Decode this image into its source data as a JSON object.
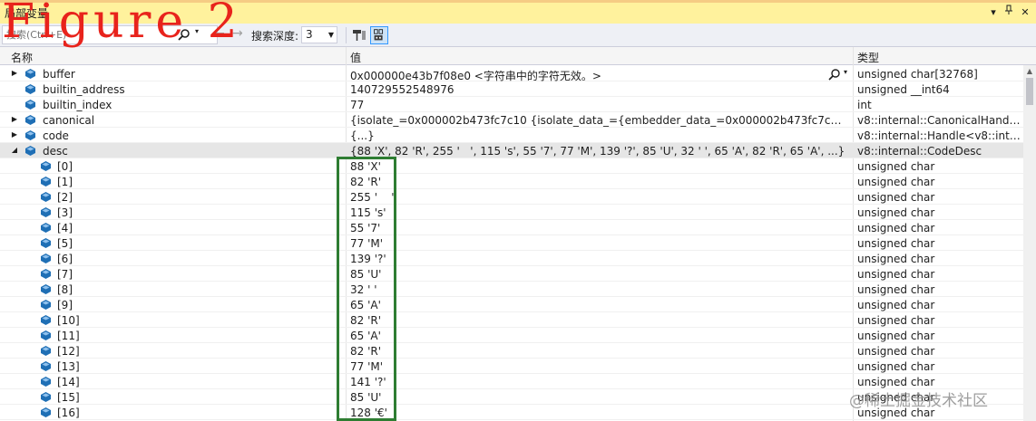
{
  "window": {
    "title": "局部变量",
    "pin_icon": "pin-icon",
    "close_icon": "close-icon"
  },
  "figure_label": "Figure 2",
  "toolbar": {
    "search_placeholder": "搜索(Ctrl+E)",
    "depth_label": "搜索深度:",
    "depth_value": "3"
  },
  "columns": {
    "name": "名称",
    "value": "值",
    "type": "类型"
  },
  "rows": [
    {
      "name": "buffer",
      "value": "0x000000e43b7f08e0 <字符串中的字符无效。>",
      "type": "unsigned char[32768]",
      "expander": "collapsed",
      "level": 0
    },
    {
      "name": "builtin_address",
      "value": "140729552548976",
      "type": "unsigned __int64",
      "expander": "none",
      "level": 0
    },
    {
      "name": "builtin_index",
      "value": "77",
      "type": "int",
      "expander": "none",
      "level": 0
    },
    {
      "name": "canonical",
      "value": "{isolate_=0x000002b473fc7c10 {isolate_data_={embedder_data_=0x000002b473fc7c10 {0x0000000000000...",
      "type": "v8::internal::CanonicalHandleSc...",
      "expander": "collapsed",
      "level": 0
    },
    {
      "name": "code",
      "value": "{...}",
      "type": "v8::internal::Handle<v8::internal:...",
      "expander": "collapsed",
      "level": 0
    },
    {
      "name": "desc",
      "value": "{88 'X', 82 'R', 255 '   ', 115 's', 55 '7', 77 'M', 139 '?', 85 'U', 32 ' ', 65 'A', 82 'R', 65 'A', ...}",
      "type": "v8::internal::CodeDesc",
      "expander": "expanded",
      "level": 0,
      "selected": true
    },
    {
      "name": "[0]",
      "value": "88 'X'",
      "type": "unsigned char",
      "expander": "none",
      "level": 1
    },
    {
      "name": "[1]",
      "value": "82 'R'",
      "type": "unsigned char",
      "expander": "none",
      "level": 1
    },
    {
      "name": "[2]",
      "value": "255 '    '",
      "type": "unsigned char",
      "expander": "none",
      "level": 1
    },
    {
      "name": "[3]",
      "value": "115 's'",
      "type": "unsigned char",
      "expander": "none",
      "level": 1
    },
    {
      "name": "[4]",
      "value": "55 '7'",
      "type": "unsigned char",
      "expander": "none",
      "level": 1
    },
    {
      "name": "[5]",
      "value": "77 'M'",
      "type": "unsigned char",
      "expander": "none",
      "level": 1
    },
    {
      "name": "[6]",
      "value": "139 '?'",
      "type": "unsigned char",
      "expander": "none",
      "level": 1
    },
    {
      "name": "[7]",
      "value": "85 'U'",
      "type": "unsigned char",
      "expander": "none",
      "level": 1
    },
    {
      "name": "[8]",
      "value": "32 ' '",
      "type": "unsigned char",
      "expander": "none",
      "level": 1
    },
    {
      "name": "[9]",
      "value": "65 'A'",
      "type": "unsigned char",
      "expander": "none",
      "level": 1
    },
    {
      "name": "[10]",
      "value": "82 'R'",
      "type": "unsigned char",
      "expander": "none",
      "level": 1
    },
    {
      "name": "[11]",
      "value": "65 'A'",
      "type": "unsigned char",
      "expander": "none",
      "level": 1
    },
    {
      "name": "[12]",
      "value": "82 'R'",
      "type": "unsigned char",
      "expander": "none",
      "level": 1
    },
    {
      "name": "[13]",
      "value": "77 'M'",
      "type": "unsigned char",
      "expander": "none",
      "level": 1
    },
    {
      "name": "[14]",
      "value": "141 '?'",
      "type": "unsigned char",
      "expander": "none",
      "level": 1
    },
    {
      "name": "[15]",
      "value": "85 'U'",
      "type": "unsigned char",
      "expander": "none",
      "level": 1
    },
    {
      "name": "[16]",
      "value": "128 '€'",
      "type": "unsigned char",
      "expander": "none",
      "level": 1
    }
  ],
  "watermark": "@稀土掘金技术社区",
  "colors": {
    "title_bg": "#fff29d",
    "figure_label": "#e8231c",
    "highlight_box": "#2e7d32",
    "object_icon": "#1f6fb5"
  }
}
